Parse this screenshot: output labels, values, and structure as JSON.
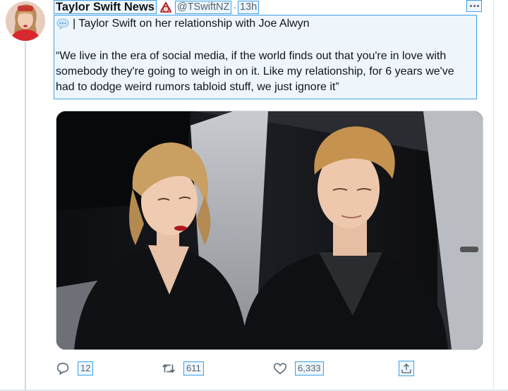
{
  "tweet": {
    "author_name": "Taylor Swift News",
    "handle": "@TSwiftNZ",
    "separator": "·",
    "time": "13h",
    "intro": "| Taylor Swift on her relationship with Joe Alwyn",
    "quote": "“We live in the era of social media, if the world finds out that you're in love with somebody they're going to weigh in on it. Like my relationship, for 6 years we've had to dodge weird rumors tabloid stuff, we just ignore it”"
  },
  "icons": {
    "avatar": "avatar-image",
    "badge": "camera-emoji-icon",
    "intro_emoji": "speech-balloon-icon",
    "more": "more-dots-icon",
    "reply": "reply-icon",
    "retweet": "retweet-icon",
    "like": "heart-icon",
    "share": "share-icon"
  },
  "actions": {
    "replies": "12",
    "retweets": "611",
    "likes": "6,333"
  },
  "colors": {
    "accent": "#1d9bf0",
    "text": "#0f1419",
    "muted": "#536471",
    "highlight_border": "#3aa0e8"
  }
}
